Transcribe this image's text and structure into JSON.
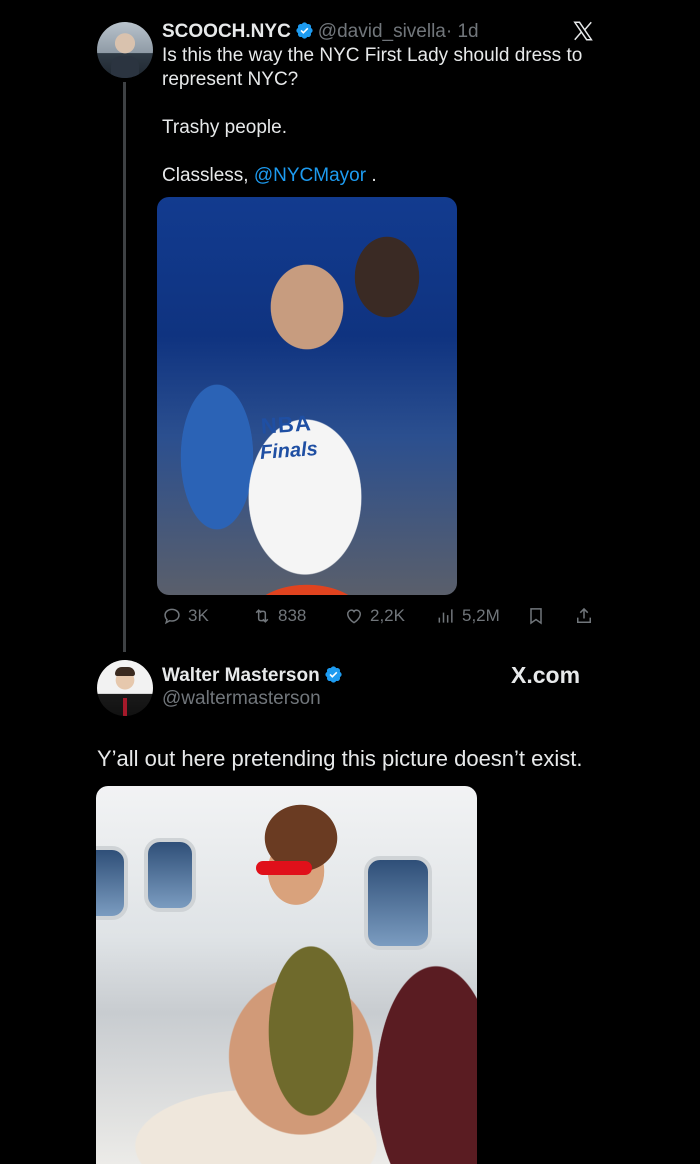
{
  "tweet": {
    "author_name": "SCOOCH.NYC",
    "author_handle": "@david_sivella",
    "time": "· 1d",
    "text_line1": "Is this the way the NYC First Lady should dress to represent NYC?",
    "text_line2": "Trashy people.",
    "text_line3_prefix": "Classless, ",
    "mention": "@NYCMayor",
    "text_line3_suffix": " .",
    "media_text_top": "NBA",
    "media_text_bottom": "Finals",
    "stats": {
      "replies": "3K",
      "reposts": "838",
      "likes": "2,2K",
      "views": "5,2M"
    }
  },
  "reply": {
    "author_name": "Walter Masterson",
    "author_handle": "@waltermasterson",
    "site": "X.com",
    "text": "Y’all out here pretending this picture doesn’t exist."
  },
  "colors": {
    "background": "#000000",
    "text": "#e7e9ea",
    "muted": "#71767b",
    "accent": "#1d9bf0"
  },
  "icons": [
    "verified-badge-icon",
    "x-logo-icon",
    "reply-icon",
    "repost-icon",
    "like-icon",
    "views-icon",
    "bookmark-icon",
    "share-icon"
  ]
}
